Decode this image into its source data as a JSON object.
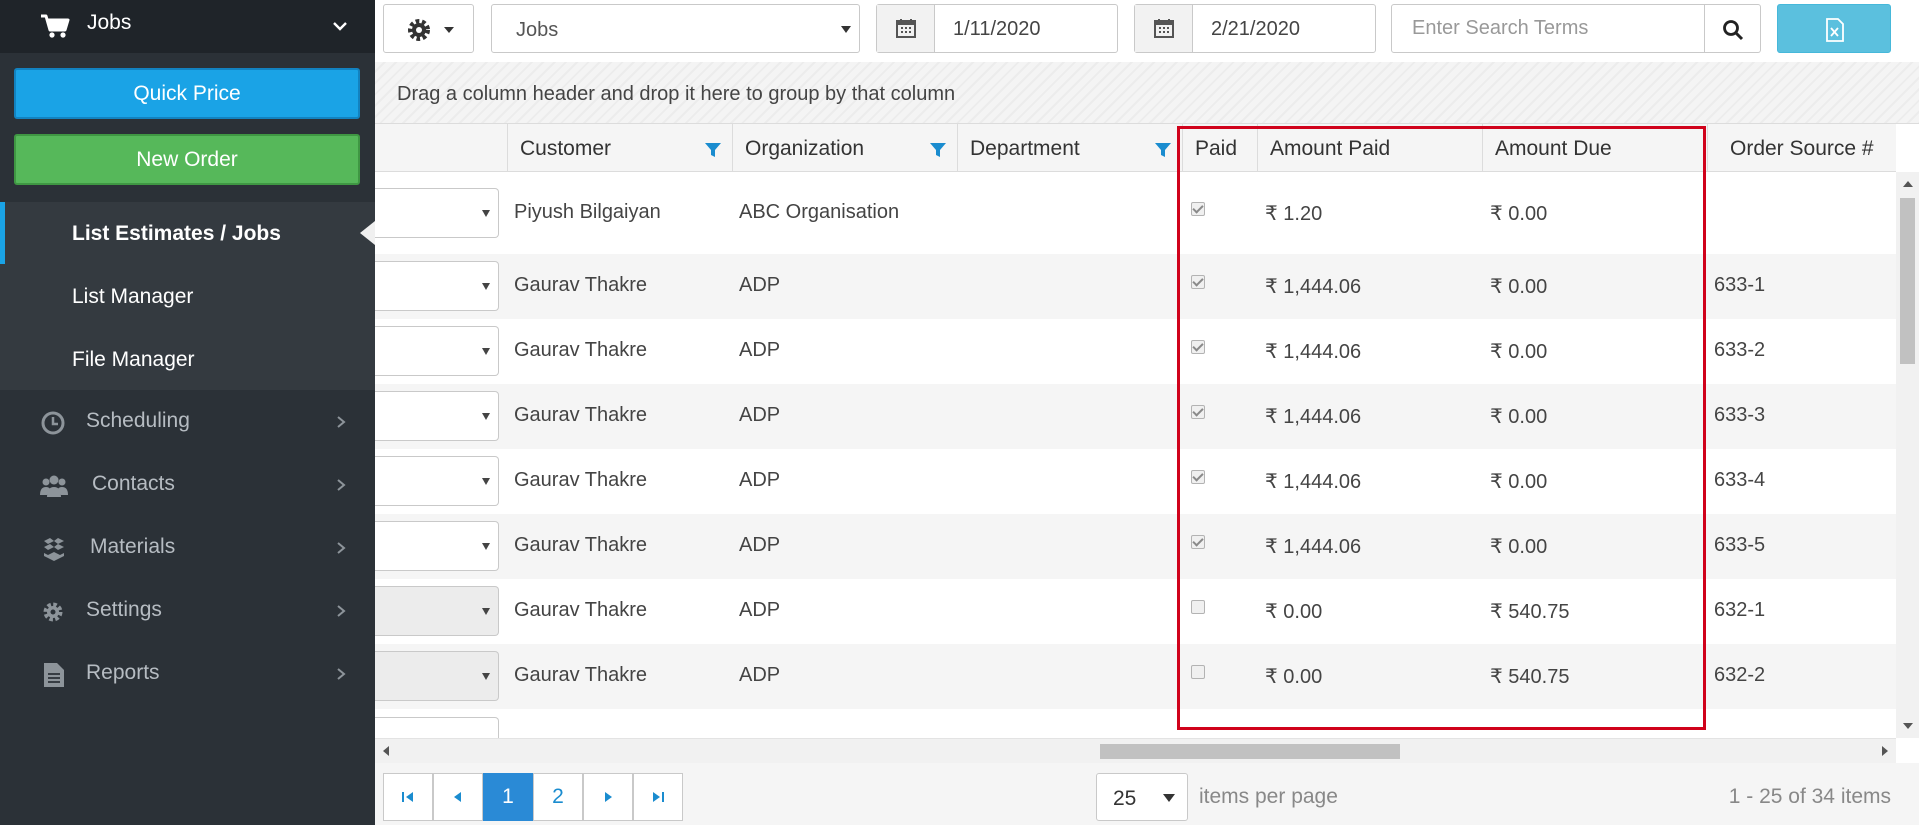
{
  "sidebar": {
    "module_title": "Jobs",
    "quick_price_label": "Quick Price",
    "new_order_label": "New Order",
    "submenu": [
      {
        "label": "List Estimates / Jobs",
        "active": true
      },
      {
        "label": "List Manager",
        "active": false
      },
      {
        "label": "File Manager",
        "active": false
      }
    ],
    "nav": [
      {
        "label": "Scheduling",
        "icon": "clock-icon"
      },
      {
        "label": "Contacts",
        "icon": "users-icon"
      },
      {
        "label": "Materials",
        "icon": "layers-icon"
      },
      {
        "label": "Settings",
        "icon": "gear-icon"
      },
      {
        "label": "Reports",
        "icon": "document-icon"
      }
    ]
  },
  "toolbar": {
    "view_select": "Jobs",
    "start_date": "1/11/2020",
    "end_date": "2/21/2020",
    "search_placeholder": "Enter Search Terms"
  },
  "group_hint": "Drag a column header and drop it here to group by that column",
  "grid": {
    "columns": [
      {
        "key": "customer",
        "label": "Customer",
        "filter": true
      },
      {
        "key": "organization",
        "label": "Organization",
        "filter": true
      },
      {
        "key": "department",
        "label": "Department",
        "filter": true
      },
      {
        "key": "paid",
        "label": "Paid",
        "filter": false
      },
      {
        "key": "amount_paid",
        "label": "Amount Paid",
        "filter": false
      },
      {
        "key": "amount_due",
        "label": "Amount Due",
        "filter": false
      },
      {
        "key": "order_source",
        "label": "Order Source #",
        "filter": false
      }
    ],
    "rows": [
      {
        "customer": "Piyush Bilgaiyan",
        "organization": "ABC Organisation",
        "department": "",
        "paid": true,
        "amount_paid": "₹ 1.20",
        "amount_due": "₹ 0.00",
        "order_source": ""
      },
      {
        "customer": "Gaurav Thakre",
        "organization": "ADP",
        "department": "",
        "paid": true,
        "amount_paid": "₹ 1,444.06",
        "amount_due": "₹ 0.00",
        "order_source": "633-1"
      },
      {
        "customer": "Gaurav Thakre",
        "organization": "ADP",
        "department": "",
        "paid": true,
        "amount_paid": "₹ 1,444.06",
        "amount_due": "₹ 0.00",
        "order_source": "633-2"
      },
      {
        "customer": "Gaurav Thakre",
        "organization": "ADP",
        "department": "",
        "paid": true,
        "amount_paid": "₹ 1,444.06",
        "amount_due": "₹ 0.00",
        "order_source": "633-3"
      },
      {
        "customer": "Gaurav Thakre",
        "organization": "ADP",
        "department": "",
        "paid": true,
        "amount_paid": "₹ 1,444.06",
        "amount_due": "₹ 0.00",
        "order_source": "633-4"
      },
      {
        "customer": "Gaurav Thakre",
        "organization": "ADP",
        "department": "",
        "paid": true,
        "amount_paid": "₹ 1,444.06",
        "amount_due": "₹ 0.00",
        "order_source": "633-5"
      },
      {
        "customer": "Gaurav Thakre",
        "organization": "ADP",
        "department": "",
        "paid": false,
        "amount_paid": "₹ 0.00",
        "amount_due": "₹ 540.75",
        "order_source": "632-1"
      },
      {
        "customer": "Gaurav Thakre",
        "organization": "ADP",
        "department": "",
        "paid": false,
        "amount_paid": "₹ 0.00",
        "amount_due": "₹ 540.75",
        "order_source": "632-2"
      }
    ]
  },
  "pager": {
    "pages": [
      "1",
      "2"
    ],
    "current_page": "1",
    "page_size": "25",
    "page_size_label": "items per page",
    "summary": "1 - 25 of 34 items"
  },
  "colors": {
    "sidebar_bg": "#2b3137",
    "quick_price": "#1aa3e6",
    "new_order": "#56b85a",
    "excel_button": "#5bc0de",
    "highlight_box": "#d0021b",
    "active_page": "#2a8ad6"
  }
}
